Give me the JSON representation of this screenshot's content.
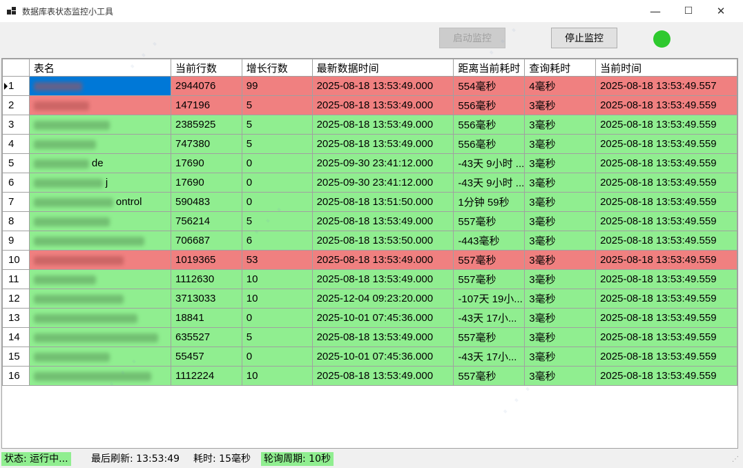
{
  "window": {
    "title": "数据库表状态监控小工具",
    "minimize": "—",
    "maximize": "☐",
    "close": "✕"
  },
  "toolbar": {
    "start_label": "启动监控",
    "stop_label": "停止监控",
    "indicator_color": "#2ec92e"
  },
  "table": {
    "columns": [
      "表名",
      "当前行数",
      "增长行数",
      "最新数据时间",
      "距离当前耗时",
      "查询耗时",
      "当前时间"
    ],
    "rows": [
      {
        "idx": "1",
        "name": "",
        "count": "2944076",
        "growth": "99",
        "latest": "2025-08-18 13:53:49.000",
        "since": "554毫秒",
        "query": "4毫秒",
        "now": "2025-08-18 13:53:49.557",
        "status": "red"
      },
      {
        "idx": "2",
        "name": "",
        "count": "147196",
        "growth": "5",
        "latest": "2025-08-18 13:53:49.000",
        "since": "556毫秒",
        "query": "3毫秒",
        "now": "2025-08-18 13:53:49.559",
        "status": "red"
      },
      {
        "idx": "3",
        "name": "",
        "count": "2385925",
        "growth": "5",
        "latest": "2025-08-18 13:53:49.000",
        "since": "556毫秒",
        "query": "3毫秒",
        "now": "2025-08-18 13:53:49.559",
        "status": "green"
      },
      {
        "idx": "4",
        "name": "",
        "count": "747380",
        "growth": "5",
        "latest": "2025-08-18 13:53:49.000",
        "since": "556毫秒",
        "query": "3毫秒",
        "now": "2025-08-18 13:53:49.559",
        "status": "green"
      },
      {
        "idx": "5",
        "name": "de",
        "count": "17690",
        "growth": "0",
        "latest": "2025-09-30 23:41:12.000",
        "since": "-43天 9小时 ...",
        "query": "3毫秒",
        "now": "2025-08-18 13:53:49.559",
        "status": "green"
      },
      {
        "idx": "6",
        "name": "j",
        "count": "17690",
        "growth": "0",
        "latest": "2025-09-30 23:41:12.000",
        "since": "-43天 9小时 ...",
        "query": "3毫秒",
        "now": "2025-08-18 13:53:49.559",
        "status": "green"
      },
      {
        "idx": "7",
        "name": "ontrol",
        "count": "590483",
        "growth": "0",
        "latest": "2025-08-18 13:51:50.000",
        "since": "1分钟 59秒",
        "query": "3毫秒",
        "now": "2025-08-18 13:53:49.559",
        "status": "green"
      },
      {
        "idx": "8",
        "name": "",
        "count": "756214",
        "growth": "5",
        "latest": "2025-08-18 13:53:49.000",
        "since": "557毫秒",
        "query": "3毫秒",
        "now": "2025-08-18 13:53:49.559",
        "status": "green"
      },
      {
        "idx": "9",
        "name": "",
        "count": "706687",
        "growth": "6",
        "latest": "2025-08-18 13:53:50.000",
        "since": "-443毫秒",
        "query": "3毫秒",
        "now": "2025-08-18 13:53:49.559",
        "status": "green"
      },
      {
        "idx": "10",
        "name": "",
        "count": "1019365",
        "growth": "53",
        "latest": "2025-08-18 13:53:49.000",
        "since": "557毫秒",
        "query": "3毫秒",
        "now": "2025-08-18 13:53:49.559",
        "status": "red"
      },
      {
        "idx": "11",
        "name": "",
        "count": "1112630",
        "growth": "10",
        "latest": "2025-08-18 13:53:49.000",
        "since": "557毫秒",
        "query": "3毫秒",
        "now": "2025-08-18 13:53:49.559",
        "status": "green"
      },
      {
        "idx": "12",
        "name": "",
        "count": "3713033",
        "growth": "10",
        "latest": "2025-12-04 09:23:20.000",
        "since": "-107天 19小...",
        "query": "3毫秒",
        "now": "2025-08-18 13:53:49.559",
        "status": "green"
      },
      {
        "idx": "13",
        "name": "",
        "count": "18841",
        "growth": "0",
        "latest": "2025-10-01 07:45:36.000",
        "since": "-43天 17小...",
        "query": "3毫秒",
        "now": "2025-08-18 13:53:49.559",
        "status": "green"
      },
      {
        "idx": "14",
        "name": "",
        "count": "635527",
        "growth": "5",
        "latest": "2025-08-18 13:53:49.000",
        "since": "557毫秒",
        "query": "3毫秒",
        "now": "2025-08-18 13:53:49.559",
        "status": "green"
      },
      {
        "idx": "15",
        "name": "",
        "count": "55457",
        "growth": "0",
        "latest": "2025-10-01 07:45:36.000",
        "since": "-43天 17小...",
        "query": "3毫秒",
        "now": "2025-08-18 13:53:49.559",
        "status": "green"
      },
      {
        "idx": "16",
        "name": "",
        "count": "1112224",
        "growth": "10",
        "latest": "2025-08-18 13:53:49.000",
        "since": "557毫秒",
        "query": "3毫秒",
        "now": "2025-08-18 13:53:49.559",
        "status": "green"
      }
    ]
  },
  "statusbar": {
    "state": "状态: 运行中...",
    "last_refresh": "最后刷新: 13:53:49",
    "elapsed": "耗时: 15毫秒",
    "poll": "轮询周期: 10秒"
  },
  "colors": {
    "ok": "#90ee90",
    "alert": "#f08080",
    "selected": "#0078d7"
  }
}
